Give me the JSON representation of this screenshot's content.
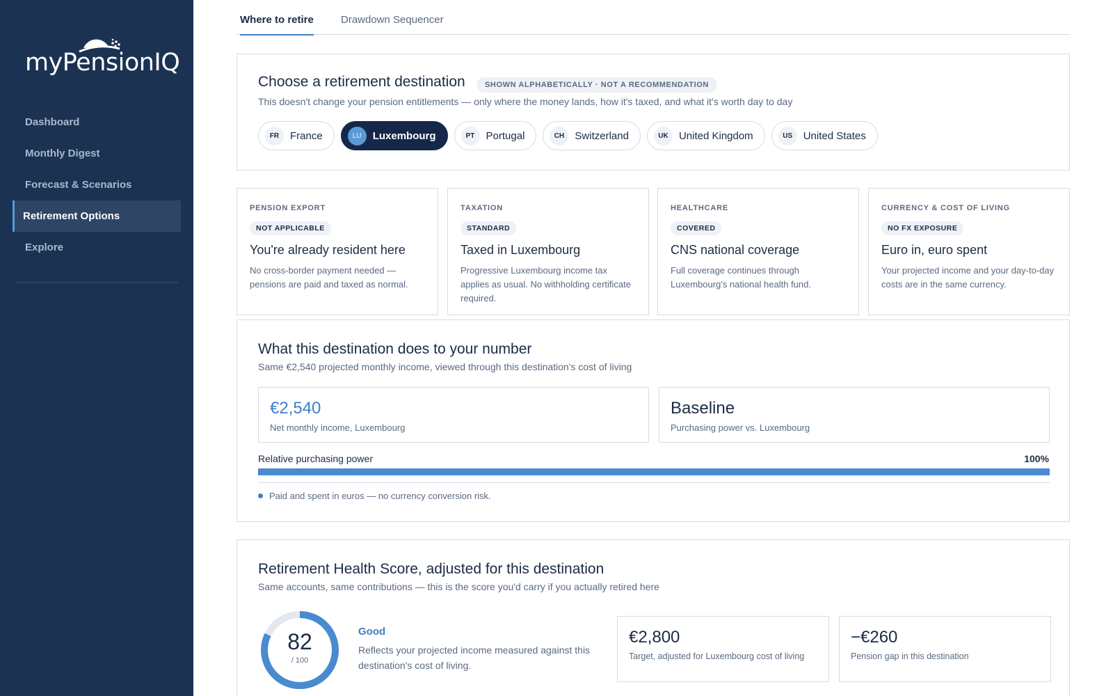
{
  "app": {
    "logo_text": "myPensionIQ"
  },
  "sidebar": {
    "items": [
      {
        "label": "Dashboard"
      },
      {
        "label": "Monthly Digest"
      },
      {
        "label": "Forecast & Scenarios"
      },
      {
        "label": "Retirement Options",
        "active": true
      },
      {
        "label": "Explore"
      }
    ]
  },
  "tabs": [
    {
      "label": "Where to retire",
      "active": true
    },
    {
      "label": "Drawdown Sequencer"
    }
  ],
  "destination": {
    "title": "Choose a retirement destination",
    "badge": "SHOWN ALPHABETICALLY · NOT A RECOMMENDATION",
    "subtitle": "This doesn't change your pension entitlements — only where the money lands, how it's taxed, and what it's worth day to day",
    "countries": [
      {
        "code": "FR",
        "name": "France"
      },
      {
        "code": "LU",
        "name": "Luxembourg",
        "selected": true
      },
      {
        "code": "PT",
        "name": "Portugal"
      },
      {
        "code": "CH",
        "name": "Switzerland"
      },
      {
        "code": "UK",
        "name": "United Kingdom"
      },
      {
        "code": "US",
        "name": "United States"
      }
    ]
  },
  "info_cards": [
    {
      "label": "PENSION EXPORT",
      "pill": "NOT APPLICABLE",
      "title": "You're already resident here",
      "desc": "No cross-border payment needed — pensions are paid and taxed as normal."
    },
    {
      "label": "TAXATION",
      "pill": "STANDARD",
      "title": "Taxed in Luxembourg",
      "desc": "Progressive Luxembourg income tax applies as usual. No withholding certificate required."
    },
    {
      "label": "HEALTHCARE",
      "pill": "COVERED",
      "title": "CNS national coverage",
      "desc": "Full coverage continues through Luxembourg's national health fund."
    },
    {
      "label": "CURRENCY & COST OF LIVING",
      "pill": "NO FX EXPOSURE",
      "title": "Euro in, euro spent",
      "desc": "Your projected income and your day-to-day costs are in the same currency."
    }
  ],
  "number": {
    "title": "What this destination does to your number",
    "subtitle": "Same €2,540 projected monthly income, viewed through this destination's cost of living",
    "income_value": "€2,540",
    "income_caption": "Net monthly income, Luxembourg",
    "power_value": "Baseline",
    "power_caption": "Purchasing power vs. Luxembourg",
    "bar_label": "Relative purchasing power",
    "bar_pct_text": "100%",
    "bar_fraction": 1.0,
    "note": "Paid and spent in euros — no currency conversion risk."
  },
  "health": {
    "title": "Retirement Health Score, adjusted for this destination",
    "subtitle": "Same accounts, same contributions — this is the score you'd carry if you actually retired here",
    "score": "82",
    "score_max_text": "/ 100",
    "score_fraction": 0.82,
    "status": "Good",
    "desc": "Reflects your projected income measured against this destination's cost of living.",
    "target_value": "€2,800",
    "target_caption": "Target, adjusted for Luxembourg cost of living",
    "gap_value": "−€260",
    "gap_caption": "Pension gap in this destination"
  },
  "colors": {
    "sidebar_bg": "#1c3253",
    "accent": "#3f7fc7",
    "chip_active": "#15284a"
  }
}
